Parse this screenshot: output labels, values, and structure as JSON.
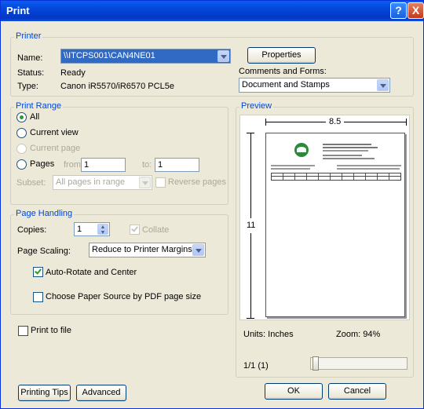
{
  "window": {
    "title": "Print"
  },
  "titlebar_buttons": {
    "help": "?",
    "close": "X"
  },
  "printer": {
    "group_label": "Printer",
    "name_label": "Name:",
    "name_value": "\\\\ITCPS001\\CAN4NE01",
    "properties_button": "Properties",
    "status_label": "Status:",
    "status_value": "Ready",
    "type_label": "Type:",
    "type_value": "Canon iR5570/iR6570 PCL5e",
    "comments_label": "Comments and Forms:",
    "comments_value": "Document and Stamps"
  },
  "print_range": {
    "group_label": "Print Range",
    "all": "All",
    "current_view": "Current view",
    "current_page": "Current page",
    "pages": "Pages",
    "from_label": "from:",
    "from_value": "1",
    "to_label": "to:",
    "to_value": "1",
    "subset_label": "Subset:",
    "subset_value": "All pages in range",
    "reverse_pages": "Reverse pages",
    "selected": "All"
  },
  "page_handling": {
    "group_label": "Page Handling",
    "copies_label": "Copies:",
    "copies_value": "1",
    "collate": "Collate",
    "scaling_label": "Page Scaling:",
    "scaling_value": "Reduce to Printer Margins",
    "auto_rotate": "Auto-Rotate and Center",
    "auto_rotate_checked": true,
    "choose_source": "Choose Paper Source by PDF page size",
    "choose_source_checked": false
  },
  "print_to_file": {
    "label": "Print to file",
    "checked": false
  },
  "preview": {
    "group_label": "Preview",
    "width_label": "8.5",
    "height_label": "11",
    "units": "Units: Inches",
    "zoom": "Zoom:  94%",
    "page_indicator": "1/1 (1)"
  },
  "buttons": {
    "printing_tips": "Printing Tips",
    "advanced": "Advanced",
    "ok": "OK",
    "cancel": "Cancel"
  },
  "colors": {
    "titlebar": "#0446d8",
    "group_label": "#0046d5",
    "check_green": "#21a121",
    "face": "#ece9d8"
  }
}
